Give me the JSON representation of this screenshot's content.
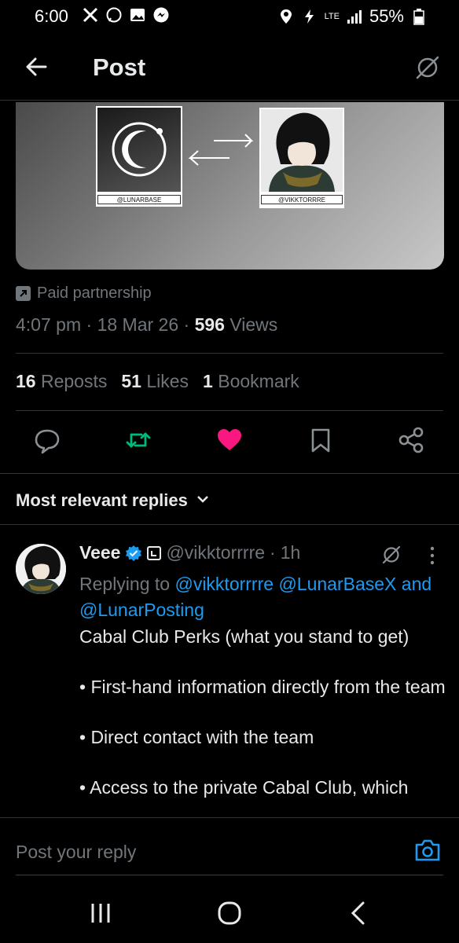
{
  "status_bar": {
    "time": "6:00",
    "lte": "LTE",
    "battery": "55%",
    "icons_left": [
      "x-icon",
      "whatsapp-icon",
      "gallery-icon",
      "messenger-icon"
    ],
    "icons_right": [
      "location-icon",
      "charging-icon",
      "lte-icon",
      "signal-icon",
      "battery-icon"
    ]
  },
  "header": {
    "title": "Post"
  },
  "media": {
    "left_tag": "@LUNARBASE",
    "right_tag": "@VIKKTORRRE"
  },
  "post_meta": {
    "paid_label": "Paid partnership",
    "time": "4:07 pm",
    "date": "18 Mar 26",
    "views_count": "596",
    "views_label": "Views",
    "sep": "·"
  },
  "stats": {
    "reposts_count": "16",
    "reposts_label": "Reposts",
    "likes_count": "51",
    "likes_label": "Likes",
    "bookmarks_count": "1",
    "bookmarks_label": "Bookmark"
  },
  "colors": {
    "accent": "#1d9bf0",
    "repost_green": "#00ba7c",
    "like_pink": "#f91880",
    "muted": "#71767b"
  },
  "sort": {
    "label": "Most relevant replies"
  },
  "reply": {
    "name": "Veee",
    "handle": "@vikktorrrre",
    "age": "1h",
    "replying_prefix": "Replying to",
    "mention1": "@vikktorrrre",
    "mention2": "@LunarBaseX",
    "and": "and",
    "mention3": "@LunarPosting",
    "lines": [
      "Cabal Club Perks (what you stand to get)",
      "• First-hand information directly from the team",
      "• Direct contact with the team",
      "• Access to the private Cabal Club, which"
    ]
  },
  "compose": {
    "placeholder": "Post your reply"
  }
}
